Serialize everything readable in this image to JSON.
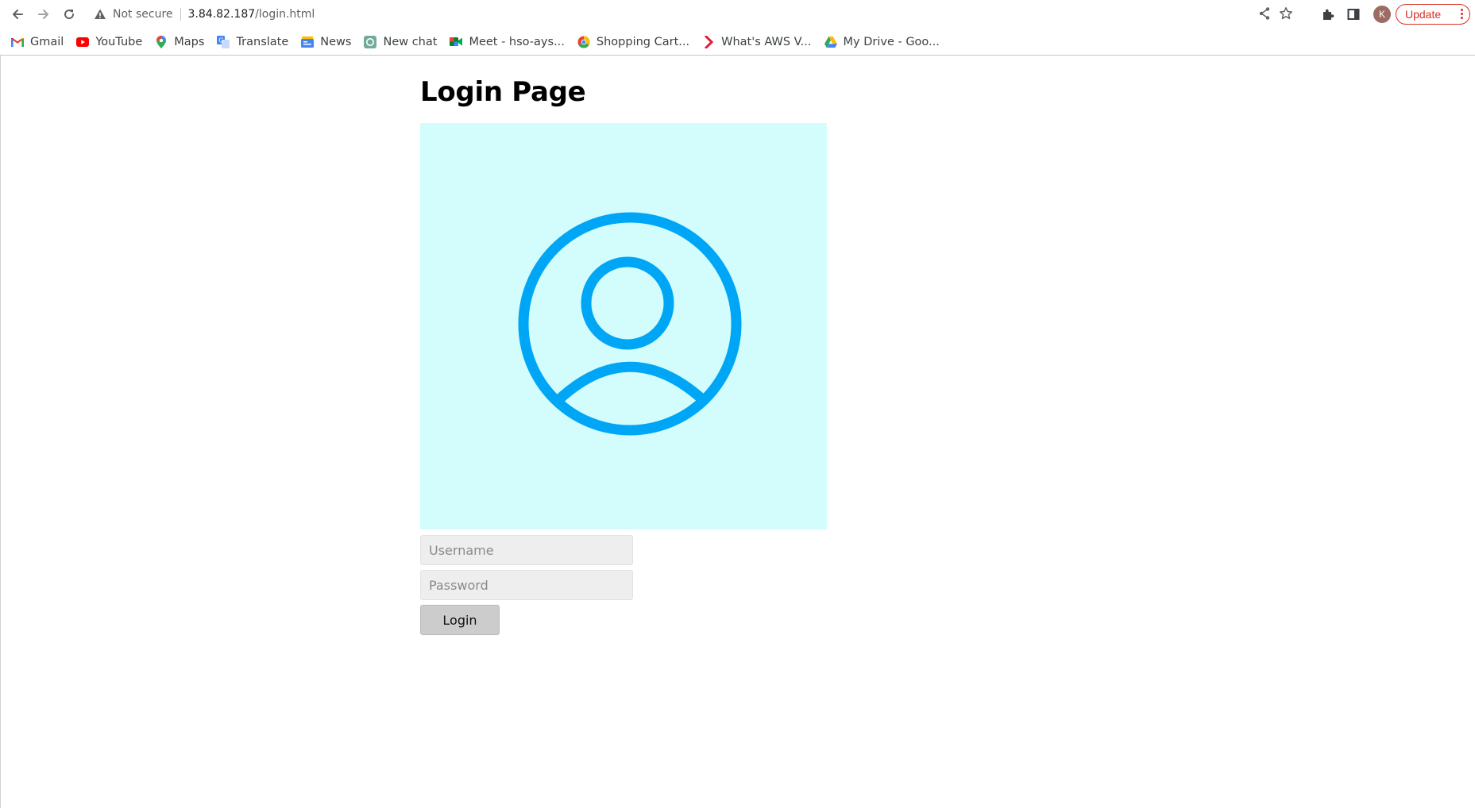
{
  "browser": {
    "security_label": "Not secure",
    "url_host": "3.84.82.187",
    "url_path": "/login.html",
    "profile_initial": "K",
    "update_label": "Update",
    "bookmarks": [
      {
        "label": "Gmail",
        "icon": "gmail-icon"
      },
      {
        "label": "YouTube",
        "icon": "youtube-icon"
      },
      {
        "label": "Maps",
        "icon": "maps-icon"
      },
      {
        "label": "Translate",
        "icon": "translate-icon"
      },
      {
        "label": "News",
        "icon": "news-icon"
      },
      {
        "label": "New chat",
        "icon": "chatgpt-icon"
      },
      {
        "label": "Meet - hso-ays...",
        "icon": "meet-icon"
      },
      {
        "label": "Shopping Cart...",
        "icon": "shopping-cart-icon"
      },
      {
        "label": "What's AWS V...",
        "icon": "aws-icon"
      },
      {
        "label": "My Drive - Goo...",
        "icon": "drive-icon"
      }
    ]
  },
  "page": {
    "title": "Login Page",
    "username_placeholder": "Username",
    "password_placeholder": "Password",
    "login_label": "Login",
    "avatar_icon": "user-circle-icon",
    "colors": {
      "avatar_bg": "#d2fdfc",
      "avatar_fg": "#00a6f6",
      "update": "#d93025"
    }
  }
}
